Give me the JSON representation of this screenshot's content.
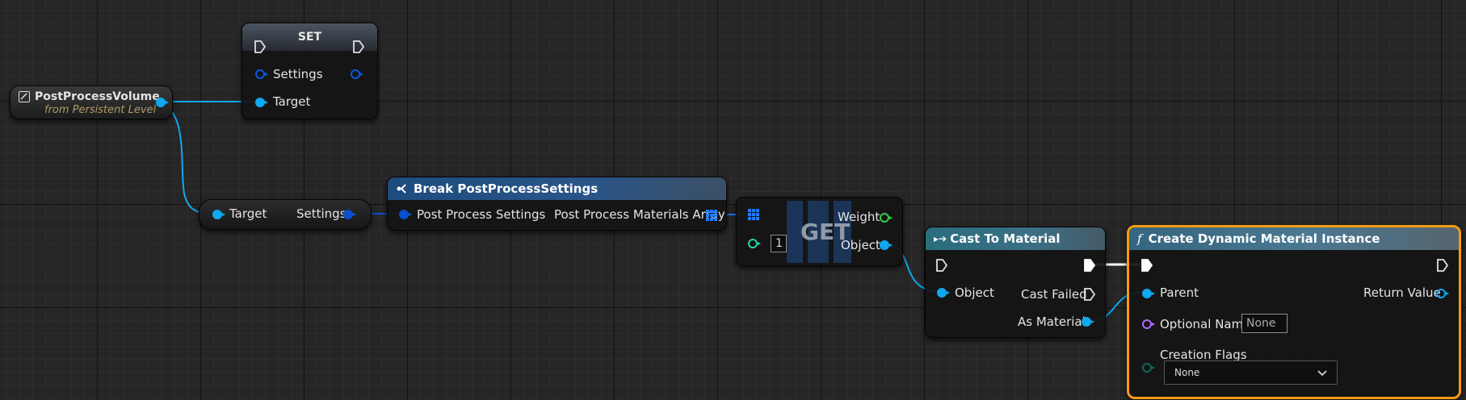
{
  "graph": {
    "postprocess_volume": {
      "title": "PostProcessVolume",
      "subtitle": "from Persistent Level"
    },
    "set_node": {
      "title": "SET",
      "settings_label": "Settings",
      "target_label": "Target"
    },
    "getter_node": {
      "target_label": "Target",
      "settings_label": "Settings"
    },
    "break_node": {
      "title": "Break PostProcessSettings",
      "input_label": "Post Process Settings",
      "output_label": "Post Process Materials Array"
    },
    "get_node": {
      "title": "GET",
      "weight_label": "Weight",
      "object_label": "Object",
      "index_value": "1"
    },
    "cast_node": {
      "title": "Cast To Material",
      "object_label": "Object",
      "cast_failed_label": "Cast Failed",
      "as_material_label": "As Material"
    },
    "create_node": {
      "title": "Create Dynamic Material Instance",
      "parent_label": "Parent",
      "return_label": "Return Value",
      "optional_name_label": "Optional Name",
      "optional_name_value": "None",
      "creation_flags_label": "Creation Flags",
      "creation_flags_value": "None"
    }
  },
  "colors": {
    "object_pin": "#10a8ef",
    "struct_pin": "#0a4fcc",
    "selection": "#f39c12",
    "func_header": "#3b6c86",
    "cast_header": "#2c6d7a",
    "break_header": "#1e4c7f"
  }
}
